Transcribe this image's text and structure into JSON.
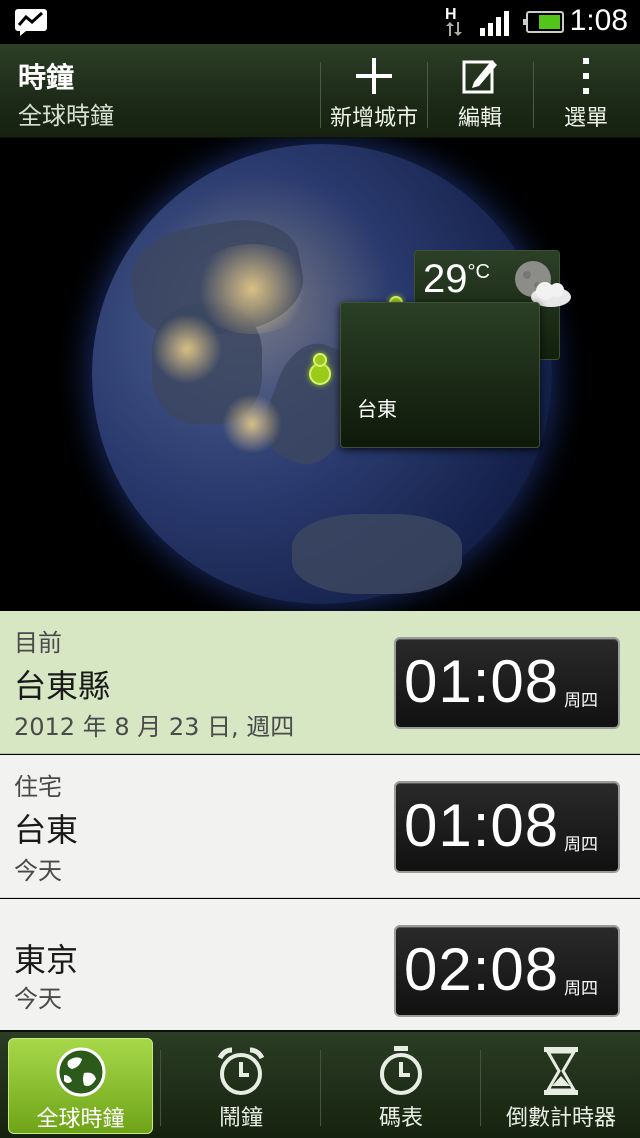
{
  "status_bar": {
    "time": "1:08",
    "network_type": "H",
    "icons": [
      "messenger-icon",
      "network-type-icon",
      "signal-icon",
      "battery-icon"
    ]
  },
  "action_bar": {
    "title": "時鐘",
    "subtitle": "全球時鐘",
    "buttons": [
      {
        "label": "新增城市",
        "icon": "plus-icon"
      },
      {
        "label": "編輯",
        "icon": "edit-icon"
      },
      {
        "label": "選單",
        "icon": "menu-dots-icon"
      }
    ]
  },
  "globe": {
    "weather": {
      "temp": "29",
      "unit": "°C",
      "icon": "moon-cloud-icon"
    },
    "city_card": {
      "name": "台東"
    }
  },
  "cities": [
    {
      "label": "目前",
      "city": "台東縣",
      "detail": "2012 年 8 月 23 日, 週四",
      "time": "01:08",
      "day": "周四"
    },
    {
      "label": "住宅",
      "city": "台東",
      "detail": "今天",
      "time": "01:08",
      "day": "周四"
    },
    {
      "label": "",
      "city": "東京",
      "detail": "今天",
      "time": "02:08",
      "day": "周四"
    }
  ],
  "tabs": [
    {
      "label": "全球時鐘",
      "icon": "globe-icon",
      "active": true
    },
    {
      "label": "鬧鐘",
      "icon": "alarm-clock-icon",
      "active": false
    },
    {
      "label": "碼表",
      "icon": "stopwatch-icon",
      "active": false
    },
    {
      "label": "倒數計時器",
      "icon": "hourglass-icon",
      "active": false
    }
  ],
  "colors": {
    "accent": "#9bcb1a",
    "current_row_bg": "#d7e7c4",
    "row_bg": "#f2f2f0",
    "bar_bg": "#1c2a17"
  }
}
